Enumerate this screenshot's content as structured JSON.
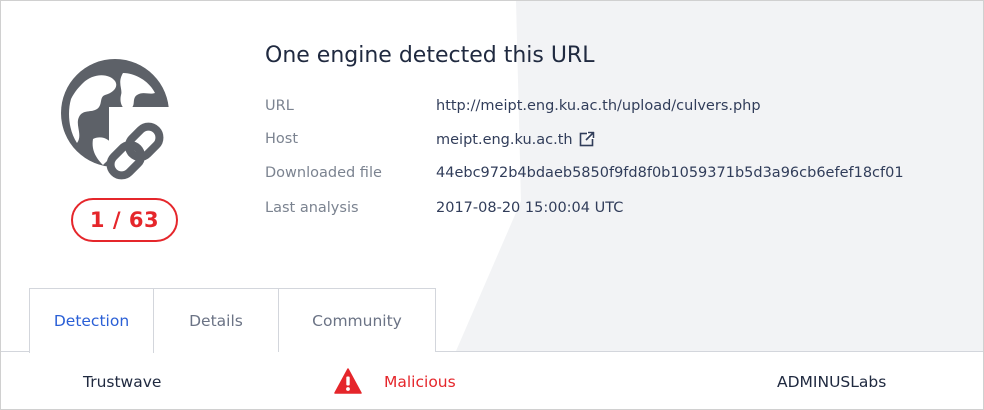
{
  "header": {
    "title": "One engine detected this URL",
    "score": "1 / 63"
  },
  "meta": {
    "url_label": "URL",
    "url_value": "http://meipt.eng.ku.ac.th/upload/culvers.php",
    "host_label": "Host",
    "host_value": "meipt.eng.ku.ac.th",
    "file_label": "Downloaded file",
    "file_value": "44ebc972b4bdaeb5850f9fd8f0b1059371b5d3a96cb6efef18cf01",
    "analysis_label": "Last analysis",
    "analysis_value": "2017-08-20 15:00:04 UTC"
  },
  "tabs": [
    {
      "label": "Detection"
    },
    {
      "label": "Details"
    },
    {
      "label": "Community"
    }
  ],
  "detections": [
    {
      "engine": "Trustwave",
      "verdict": "Malicious",
      "icon": "warning-icon"
    },
    {
      "engine": "ADMINUSLabs"
    }
  ],
  "colors": {
    "accent": "#2a5fd6",
    "danger": "#e5262b",
    "icon_gray": "#5d6168"
  }
}
